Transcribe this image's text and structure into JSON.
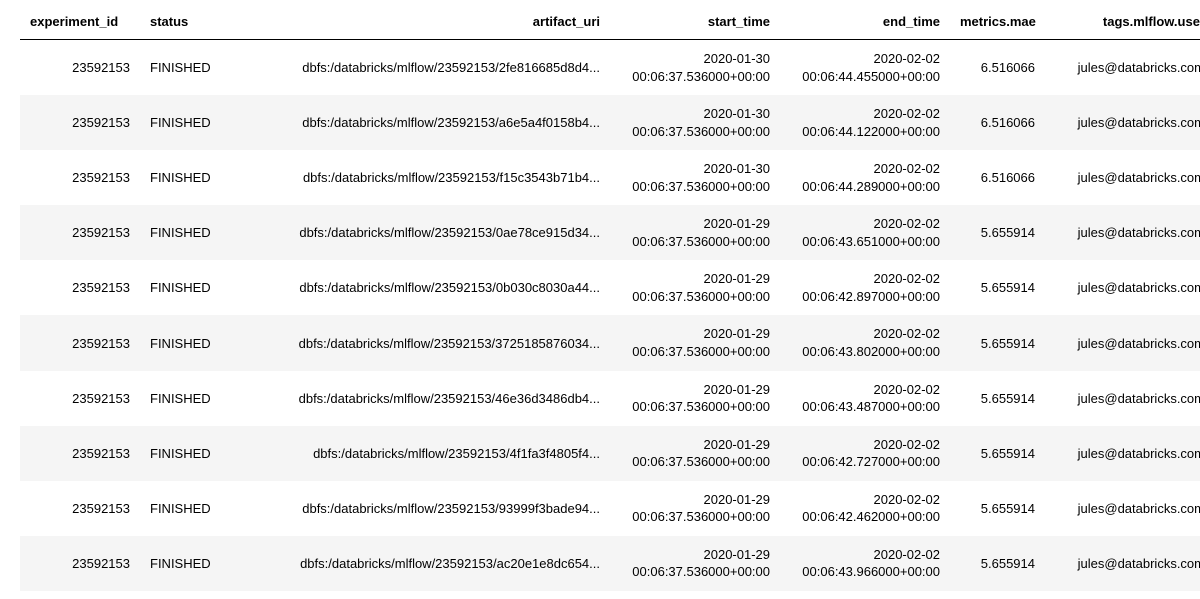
{
  "headers": {
    "experiment_id": "experiment_id",
    "status": "status",
    "artifact_uri": "artifact_uri",
    "start_time": "start_time",
    "end_time": "end_time",
    "metrics_mae": "metrics.mae",
    "tags_user": "tags.mlflow.user"
  },
  "rows": [
    {
      "experiment_id": "23592153",
      "status": "FINISHED",
      "artifact_uri": "dbfs:/databricks/mlflow/23592153/2fe816685d8d4...",
      "start_date": "2020-01-30",
      "start_ts": "00:06:37.536000+00:00",
      "end_date": "2020-02-02",
      "end_ts": "00:06:44.455000+00:00",
      "metrics_mae": "6.516066",
      "user": "jules@databricks.com"
    },
    {
      "experiment_id": "23592153",
      "status": "FINISHED",
      "artifact_uri": "dbfs:/databricks/mlflow/23592153/a6e5a4f0158b4...",
      "start_date": "2020-01-30",
      "start_ts": "00:06:37.536000+00:00",
      "end_date": "2020-02-02",
      "end_ts": "00:06:44.122000+00:00",
      "metrics_mae": "6.516066",
      "user": "jules@databricks.com"
    },
    {
      "experiment_id": "23592153",
      "status": "FINISHED",
      "artifact_uri": "dbfs:/databricks/mlflow/23592153/f15c3543b71b4...",
      "start_date": "2020-01-30",
      "start_ts": "00:06:37.536000+00:00",
      "end_date": "2020-02-02",
      "end_ts": "00:06:44.289000+00:00",
      "metrics_mae": "6.516066",
      "user": "jules@databricks.com"
    },
    {
      "experiment_id": "23592153",
      "status": "FINISHED",
      "artifact_uri": "dbfs:/databricks/mlflow/23592153/0ae78ce915d34...",
      "start_date": "2020-01-29",
      "start_ts": "00:06:37.536000+00:00",
      "end_date": "2020-02-02",
      "end_ts": "00:06:43.651000+00:00",
      "metrics_mae": "5.655914",
      "user": "jules@databricks.com"
    },
    {
      "experiment_id": "23592153",
      "status": "FINISHED",
      "artifact_uri": "dbfs:/databricks/mlflow/23592153/0b030c8030a44...",
      "start_date": "2020-01-29",
      "start_ts": "00:06:37.536000+00:00",
      "end_date": "2020-02-02",
      "end_ts": "00:06:42.897000+00:00",
      "metrics_mae": "5.655914",
      "user": "jules@databricks.com"
    },
    {
      "experiment_id": "23592153",
      "status": "FINISHED",
      "artifact_uri": "dbfs:/databricks/mlflow/23592153/3725185876034...",
      "start_date": "2020-01-29",
      "start_ts": "00:06:37.536000+00:00",
      "end_date": "2020-02-02",
      "end_ts": "00:06:43.802000+00:00",
      "metrics_mae": "5.655914",
      "user": "jules@databricks.com"
    },
    {
      "experiment_id": "23592153",
      "status": "FINISHED",
      "artifact_uri": "dbfs:/databricks/mlflow/23592153/46e36d3486db4...",
      "start_date": "2020-01-29",
      "start_ts": "00:06:37.536000+00:00",
      "end_date": "2020-02-02",
      "end_ts": "00:06:43.487000+00:00",
      "metrics_mae": "5.655914",
      "user": "jules@databricks.com"
    },
    {
      "experiment_id": "23592153",
      "status": "FINISHED",
      "artifact_uri": "dbfs:/databricks/mlflow/23592153/4f1fa3f4805f4...",
      "start_date": "2020-01-29",
      "start_ts": "00:06:37.536000+00:00",
      "end_date": "2020-02-02",
      "end_ts": "00:06:42.727000+00:00",
      "metrics_mae": "5.655914",
      "user": "jules@databricks.com"
    },
    {
      "experiment_id": "23592153",
      "status": "FINISHED",
      "artifact_uri": "dbfs:/databricks/mlflow/23592153/93999f3bade94...",
      "start_date": "2020-01-29",
      "start_ts": "00:06:37.536000+00:00",
      "end_date": "2020-02-02",
      "end_ts": "00:06:42.462000+00:00",
      "metrics_mae": "5.655914",
      "user": "jules@databricks.com"
    },
    {
      "experiment_id": "23592153",
      "status": "FINISHED",
      "artifact_uri": "dbfs:/databricks/mlflow/23592153/ac20e1e8dc654...",
      "start_date": "2020-01-29",
      "start_ts": "00:06:37.536000+00:00",
      "end_date": "2020-02-02",
      "end_ts": "00:06:43.966000+00:00",
      "metrics_mae": "5.655914",
      "user": "jules@databricks.com"
    }
  ]
}
